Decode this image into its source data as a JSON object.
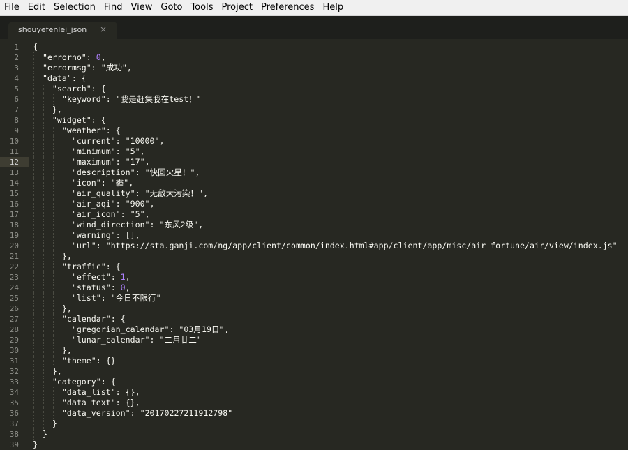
{
  "menu": {
    "items": [
      "File",
      "Edit",
      "Selection",
      "Find",
      "View",
      "Goto",
      "Tools",
      "Project",
      "Preferences",
      "Help"
    ]
  },
  "tab": {
    "label": "shouyefenlei_json",
    "close_glyph": "×"
  },
  "editor": {
    "current_line": 12,
    "lines": [
      [
        {
          "t": "p",
          "v": "{"
        }
      ],
      [
        {
          "t": "p",
          "v": "  "
        },
        {
          "t": "k",
          "v": "\"errorno\""
        },
        {
          "t": "p",
          "v": ": "
        },
        {
          "t": "n",
          "v": "0"
        },
        {
          "t": "p",
          "v": ","
        }
      ],
      [
        {
          "t": "p",
          "v": "  "
        },
        {
          "t": "k",
          "v": "\"errormsg\""
        },
        {
          "t": "p",
          "v": ": "
        },
        {
          "t": "s",
          "v": "\"成功\""
        },
        {
          "t": "p",
          "v": ","
        }
      ],
      [
        {
          "t": "p",
          "v": "  "
        },
        {
          "t": "k",
          "v": "\"data\""
        },
        {
          "t": "p",
          "v": ": {"
        }
      ],
      [
        {
          "t": "p",
          "v": "    "
        },
        {
          "t": "k",
          "v": "\"search\""
        },
        {
          "t": "p",
          "v": ": {"
        }
      ],
      [
        {
          "t": "p",
          "v": "      "
        },
        {
          "t": "k",
          "v": "\"keyword\""
        },
        {
          "t": "p",
          "v": ": "
        },
        {
          "t": "s",
          "v": "\"我是赶集我在test！\""
        }
      ],
      [
        {
          "t": "p",
          "v": "    },"
        }
      ],
      [
        {
          "t": "p",
          "v": "    "
        },
        {
          "t": "k",
          "v": "\"widget\""
        },
        {
          "t": "p",
          "v": ": {"
        }
      ],
      [
        {
          "t": "p",
          "v": "      "
        },
        {
          "t": "k",
          "v": "\"weather\""
        },
        {
          "t": "p",
          "v": ": {"
        }
      ],
      [
        {
          "t": "p",
          "v": "        "
        },
        {
          "t": "k",
          "v": "\"current\""
        },
        {
          "t": "p",
          "v": ": "
        },
        {
          "t": "s",
          "v": "\"10000\""
        },
        {
          "t": "p",
          "v": ","
        }
      ],
      [
        {
          "t": "p",
          "v": "        "
        },
        {
          "t": "k",
          "v": "\"minimum\""
        },
        {
          "t": "p",
          "v": ": "
        },
        {
          "t": "s",
          "v": "\"5\""
        },
        {
          "t": "p",
          "v": ","
        }
      ],
      [
        {
          "t": "p",
          "v": "        "
        },
        {
          "t": "k",
          "v": "\"maximum\""
        },
        {
          "t": "p",
          "v": ": "
        },
        {
          "t": "s",
          "v": "\"17\""
        },
        {
          "t": "p",
          "v": ","
        }
      ],
      [
        {
          "t": "p",
          "v": "        "
        },
        {
          "t": "k",
          "v": "\"description\""
        },
        {
          "t": "p",
          "v": ": "
        },
        {
          "t": "s",
          "v": "\"快回火星！\""
        },
        {
          "t": "p",
          "v": ","
        }
      ],
      [
        {
          "t": "p",
          "v": "        "
        },
        {
          "t": "k",
          "v": "\"icon\""
        },
        {
          "t": "p",
          "v": ": "
        },
        {
          "t": "s",
          "v": "\"霾\""
        },
        {
          "t": "p",
          "v": ","
        }
      ],
      [
        {
          "t": "p",
          "v": "        "
        },
        {
          "t": "k",
          "v": "\"air_quality\""
        },
        {
          "t": "p",
          "v": ": "
        },
        {
          "t": "s",
          "v": "\"无敌大污染！\""
        },
        {
          "t": "p",
          "v": ","
        }
      ],
      [
        {
          "t": "p",
          "v": "        "
        },
        {
          "t": "k",
          "v": "\"air_aqi\""
        },
        {
          "t": "p",
          "v": ": "
        },
        {
          "t": "s",
          "v": "\"900\""
        },
        {
          "t": "p",
          "v": ","
        }
      ],
      [
        {
          "t": "p",
          "v": "        "
        },
        {
          "t": "k",
          "v": "\"air_icon\""
        },
        {
          "t": "p",
          "v": ": "
        },
        {
          "t": "s",
          "v": "\"5\""
        },
        {
          "t": "p",
          "v": ","
        }
      ],
      [
        {
          "t": "p",
          "v": "        "
        },
        {
          "t": "k",
          "v": "\"wind_direction\""
        },
        {
          "t": "p",
          "v": ": "
        },
        {
          "t": "s",
          "v": "\"东风2级\""
        },
        {
          "t": "p",
          "v": ","
        }
      ],
      [
        {
          "t": "p",
          "v": "        "
        },
        {
          "t": "k",
          "v": "\"warning\""
        },
        {
          "t": "p",
          "v": ": [],"
        }
      ],
      [
        {
          "t": "p",
          "v": "        "
        },
        {
          "t": "k",
          "v": "\"url\""
        },
        {
          "t": "p",
          "v": ": "
        },
        {
          "t": "s",
          "v": "\"https://sta.ganji.com/ng/app/client/common/index.html#app/client/app/misc/air_fortune/air/view/index.js\""
        }
      ],
      [
        {
          "t": "p",
          "v": "      },"
        }
      ],
      [
        {
          "t": "p",
          "v": "      "
        },
        {
          "t": "k",
          "v": "\"traffic\""
        },
        {
          "t": "p",
          "v": ": {"
        }
      ],
      [
        {
          "t": "p",
          "v": "        "
        },
        {
          "t": "k",
          "v": "\"effect\""
        },
        {
          "t": "p",
          "v": ": "
        },
        {
          "t": "n",
          "v": "1"
        },
        {
          "t": "p",
          "v": ","
        }
      ],
      [
        {
          "t": "p",
          "v": "        "
        },
        {
          "t": "k",
          "v": "\"status\""
        },
        {
          "t": "p",
          "v": ": "
        },
        {
          "t": "n",
          "v": "0"
        },
        {
          "t": "p",
          "v": ","
        }
      ],
      [
        {
          "t": "p",
          "v": "        "
        },
        {
          "t": "k",
          "v": "\"list\""
        },
        {
          "t": "p",
          "v": ": "
        },
        {
          "t": "s",
          "v": "\"今日不限行\""
        }
      ],
      [
        {
          "t": "p",
          "v": "      },"
        }
      ],
      [
        {
          "t": "p",
          "v": "      "
        },
        {
          "t": "k",
          "v": "\"calendar\""
        },
        {
          "t": "p",
          "v": ": {"
        }
      ],
      [
        {
          "t": "p",
          "v": "        "
        },
        {
          "t": "k",
          "v": "\"gregorian_calendar\""
        },
        {
          "t": "p",
          "v": ": "
        },
        {
          "t": "s",
          "v": "\"03月19日\""
        },
        {
          "t": "p",
          "v": ","
        }
      ],
      [
        {
          "t": "p",
          "v": "        "
        },
        {
          "t": "k",
          "v": "\"lunar_calendar\""
        },
        {
          "t": "p",
          "v": ": "
        },
        {
          "t": "s",
          "v": "\"二月廿二\""
        }
      ],
      [
        {
          "t": "p",
          "v": "      },"
        }
      ],
      [
        {
          "t": "p",
          "v": "      "
        },
        {
          "t": "k",
          "v": "\"theme\""
        },
        {
          "t": "p",
          "v": ": {}"
        }
      ],
      [
        {
          "t": "p",
          "v": "    },"
        }
      ],
      [
        {
          "t": "p",
          "v": "    "
        },
        {
          "t": "k",
          "v": "\"category\""
        },
        {
          "t": "p",
          "v": ": {"
        }
      ],
      [
        {
          "t": "p",
          "v": "      "
        },
        {
          "t": "k",
          "v": "\"data_list\""
        },
        {
          "t": "p",
          "v": ": {},"
        }
      ],
      [
        {
          "t": "p",
          "v": "      "
        },
        {
          "t": "k",
          "v": "\"data_text\""
        },
        {
          "t": "p",
          "v": ": {},"
        }
      ],
      [
        {
          "t": "p",
          "v": "      "
        },
        {
          "t": "k",
          "v": "\"data_version\""
        },
        {
          "t": "p",
          "v": ": "
        },
        {
          "t": "s",
          "v": "\"20170227211912798\""
        }
      ],
      [
        {
          "t": "p",
          "v": "    }"
        }
      ],
      [
        {
          "t": "p",
          "v": "  }"
        }
      ],
      [
        {
          "t": "p",
          "v": "}"
        }
      ]
    ]
  },
  "colors": {
    "background": "#272822",
    "tabbar": "#1e1f1c",
    "text": "#f8f8f2",
    "number": "#ae81ff",
    "gutter_text": "#8f908a",
    "current_line": "#3e3d32"
  }
}
